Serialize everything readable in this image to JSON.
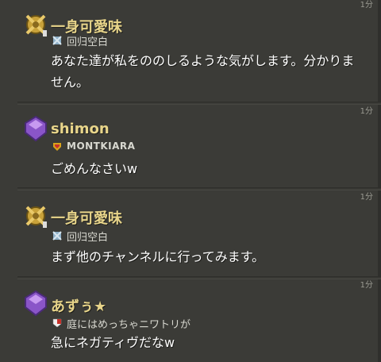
{
  "top_time": "1分",
  "messages": [
    {
      "name": "一身可愛味",
      "clan": "回归空白",
      "text": "あなた達が私をののしるような気がします。分かりません。",
      "time": "1分",
      "badge": "crossed-swords-icon",
      "clan_icon": "clan-badge-icon"
    },
    {
      "name": "shimon",
      "clan": "MONTKIARA",
      "text": "ごめんなさいw",
      "time": "1分",
      "badge": "purple-league-icon",
      "clan_icon": "clan-badge-icon"
    },
    {
      "name": "一身可愛味",
      "clan": "回归空白",
      "text": "まず他のチャンネルに行ってみます。",
      "time": "1分",
      "badge": "crossed-swords-icon",
      "clan_icon": "clan-badge-icon"
    },
    {
      "name": "あずぅ★",
      "clan": "庭にはめっちゃニワトリが",
      "text": "急にネガティヴだなw",
      "time": "",
      "badge": "purple-league-icon",
      "clan_icon": "clan-badge-icon"
    }
  ],
  "colors": {
    "background": "#3b3b37",
    "name": "#e8d58a",
    "text": "#ffffff"
  }
}
